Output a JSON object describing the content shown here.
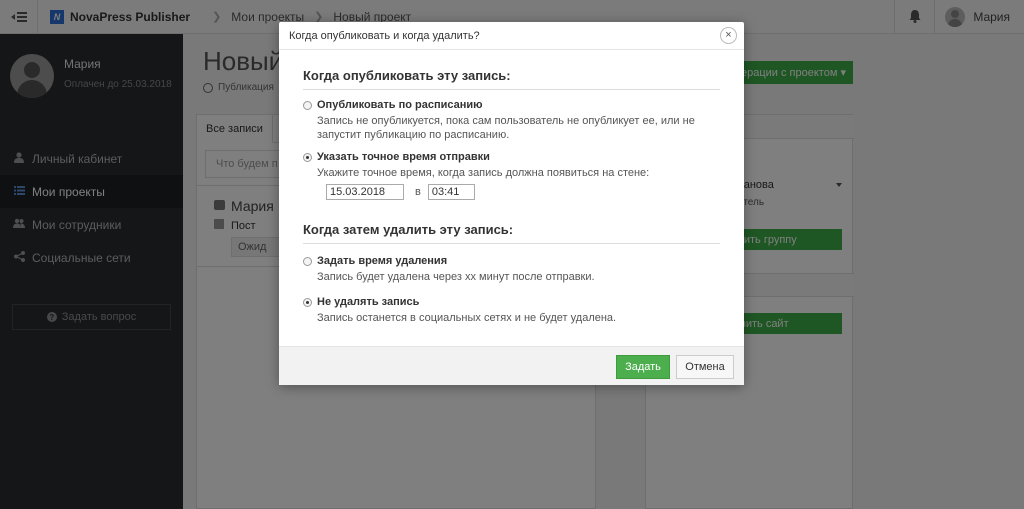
{
  "app": {
    "brand_letter": "N",
    "brand_name": "NovaPress Publisher",
    "brand_color": "#2d6fd6"
  },
  "breadcrumbs": [
    "Мои проекты",
    "Новый проект"
  ],
  "topbar": {
    "menu_icon": "menu-toggle-icon",
    "notification_icon": "bell-icon",
    "user_name": "Мария"
  },
  "sidebar": {
    "user_name": "Мария",
    "paid_until": "Оплачен до 25.03.2018",
    "items": [
      {
        "label": "Личный кабинет",
        "icon": "user-icon",
        "active": false
      },
      {
        "label": "Мои проекты",
        "icon": "list-icon",
        "active": true
      },
      {
        "label": "Мои сотрудники",
        "icon": "users-icon",
        "active": false
      },
      {
        "label": "Социальные сети",
        "icon": "share-icon",
        "active": false
      }
    ],
    "ask_button": "Задать вопрос"
  },
  "main": {
    "title": "Новый",
    "subtitle": "Публикация",
    "actions_button": "ерации с проектом ▾",
    "tab_all": "Все записи",
    "search_placeholder": "Что будем п",
    "post": {
      "author": "Мария",
      "type": "Пост",
      "status": "Ожид"
    },
    "right_panel": {
      "name": "ванова",
      "role": "атель",
      "button_group": "вить группу",
      "button_site": "вить сайт"
    }
  },
  "modal": {
    "title": "Когда опубликовать и когда удалить?",
    "close_label": "×",
    "publish_section": {
      "title": "Когда опубликовать эту запись:",
      "options": [
        {
          "label": "Опубликовать по расписанию",
          "description": "Запись не опубликуется, пока сам пользователь не опубликует ее, или не запустит публикацию по расписанию.",
          "checked": false
        },
        {
          "label": "Указать точное время отправки",
          "description": "Укажите точное время, когда запись должна появиться на стене:",
          "checked": true
        }
      ],
      "date_value": "15.03.2018",
      "at_label": "в",
      "time_value": "03:41"
    },
    "delete_section": {
      "title": "Когда затем удалить эту запись:",
      "options": [
        {
          "label": "Задать время удаления",
          "description": "Запись будет удалена через xx минут после отправки.",
          "checked": false
        },
        {
          "label": "Не удалять запись",
          "description": "Запись останется в социальных сетях и не будет удалена.",
          "checked": true
        }
      ]
    },
    "ok_button": "Задать",
    "cancel_button": "Отмена",
    "ok_color": "#4cae4c"
  }
}
